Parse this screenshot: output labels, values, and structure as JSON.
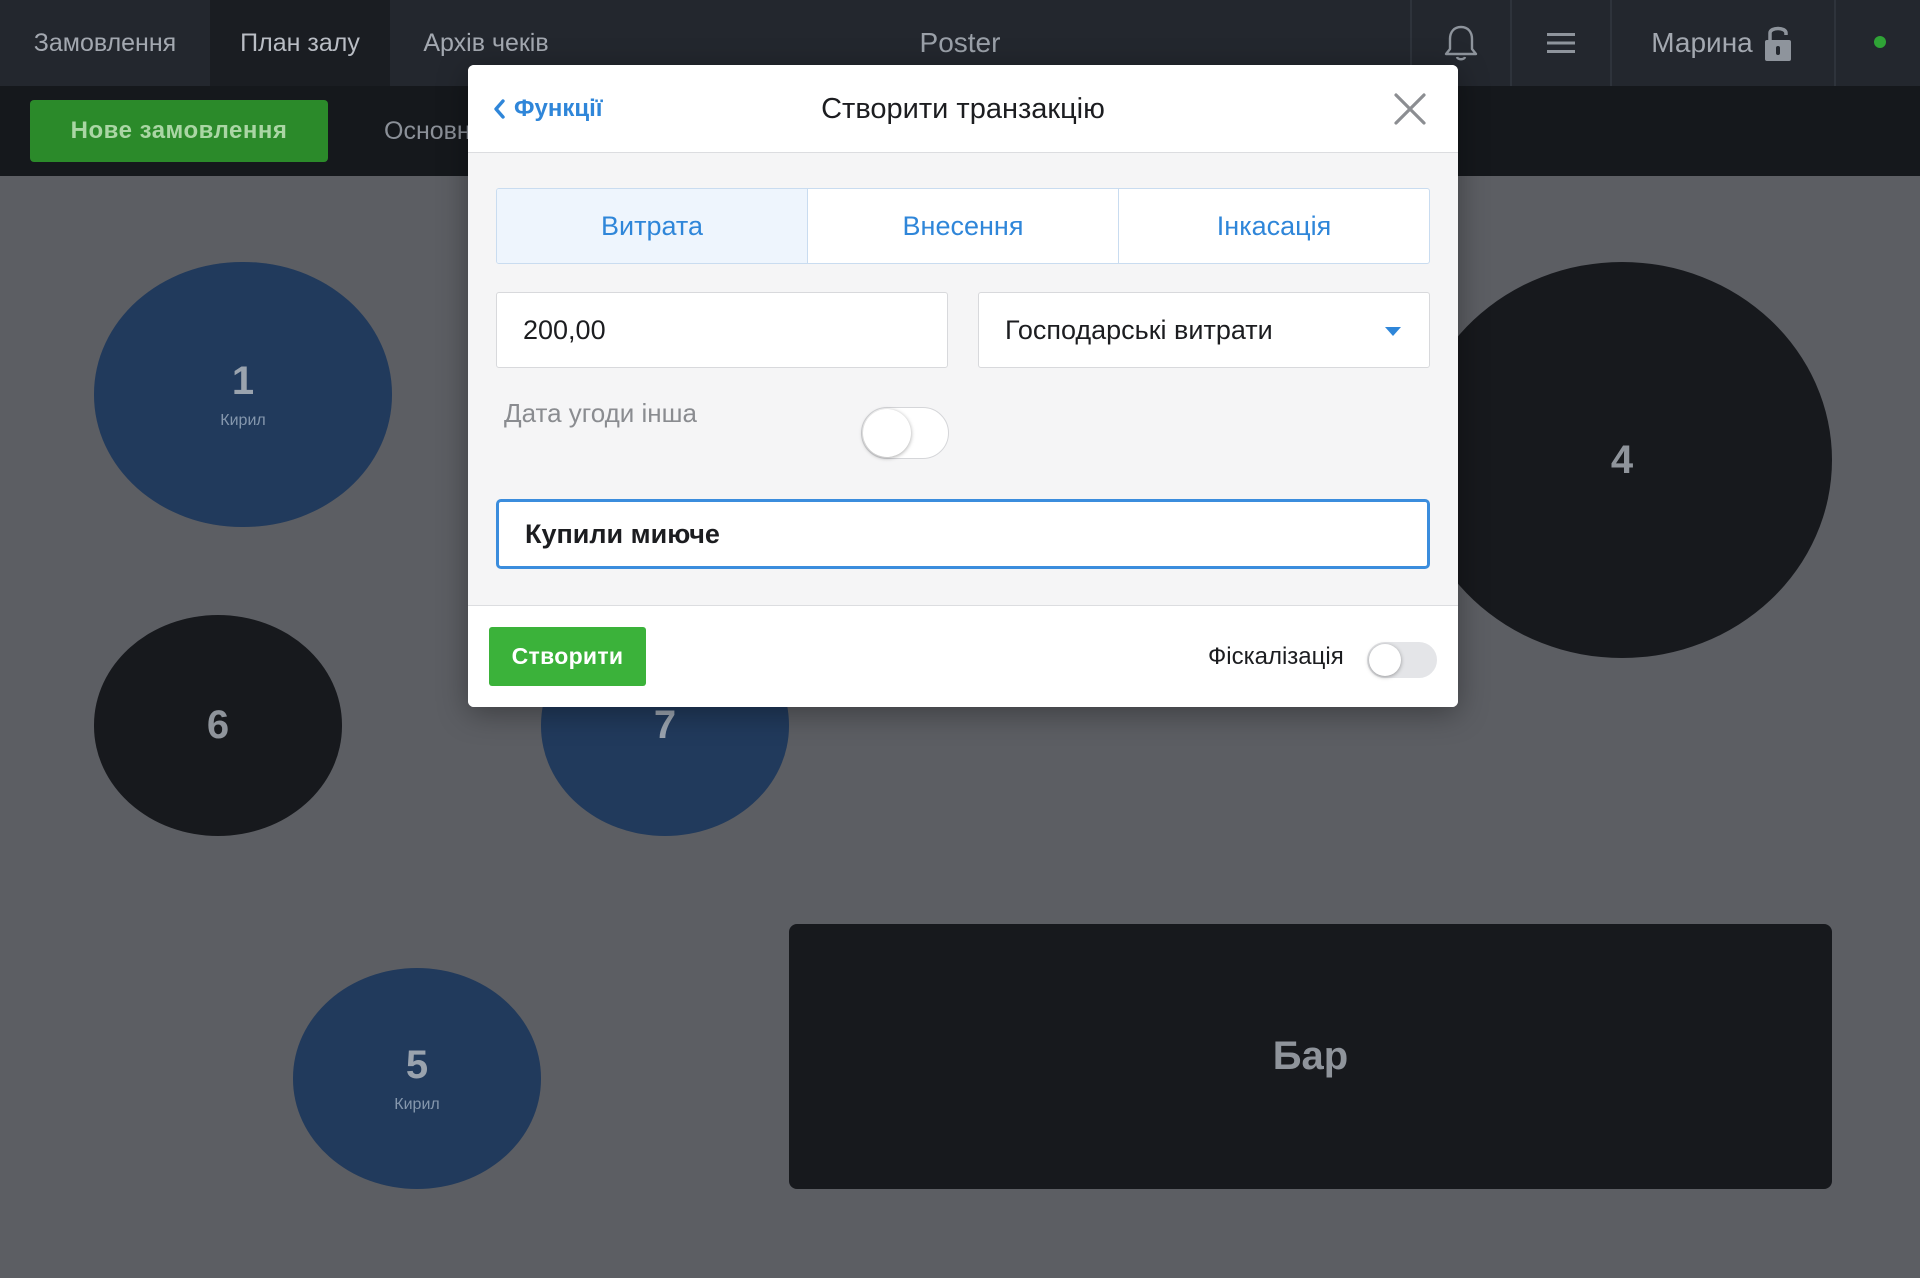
{
  "topbar": {
    "tabs": [
      {
        "label": "Замовлення"
      },
      {
        "label": "План залу"
      },
      {
        "label": "Архів чеків"
      }
    ],
    "brand": "Poster",
    "user_name": "Марина",
    "icons": {
      "bell": "bell-icon",
      "menu": "hamburger-menu-icon",
      "lock": "unlock-icon"
    },
    "status_color": "#2fa336"
  },
  "subbar": {
    "new_order_label": "Нове замовлення",
    "hall_tab_label": "Основн"
  },
  "floor": {
    "tables": [
      {
        "num": "1",
        "waiter": "Кирил"
      },
      {
        "num": "4",
        "waiter": ""
      },
      {
        "num": "6",
        "waiter": ""
      },
      {
        "num": "7",
        "waiter": ""
      },
      {
        "num": "5",
        "waiter": "Кирил"
      },
      {
        "num": "Бар",
        "waiter": ""
      }
    ]
  },
  "modal": {
    "back_label": "Функції",
    "title": "Створити транзакцію",
    "types": [
      {
        "label": "Витрата",
        "active": true
      },
      {
        "label": "Внесення",
        "active": false
      },
      {
        "label": "Інкасація",
        "active": false
      }
    ],
    "amount": "200,00",
    "category": "Господарські витрати",
    "date_other_label": "Дата угоди інша",
    "date_other_on": false,
    "comment": "Купили миюче",
    "create_label": "Створити",
    "fiscal_label": "Фіскалізація",
    "fiscal_on": false,
    "accent_color": "#2f86d9",
    "create_color": "#3bb23a"
  }
}
